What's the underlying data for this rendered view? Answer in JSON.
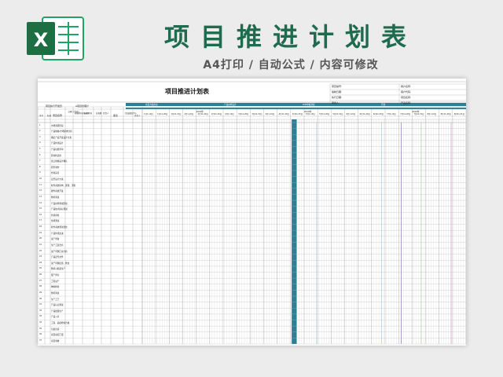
{
  "banner": {
    "title": "项目推进计划表",
    "subtitle": "A4打印 / 自动公式 / 内容可修改",
    "logo_letter": "X",
    "logo_icon": "excel-icon",
    "colors": {
      "title": "#1e6b4f",
      "logo_dark": "#1d6e42",
      "logo_light": "#21a366",
      "teal": "#2b8193"
    }
  },
  "sheet": {
    "title": "项目推进计划表",
    "info_left": [
      "项目编号:",
      "编制日期:",
      "执行日期:",
      "审批人:"
    ],
    "info_right": [
      "客户名称:",
      "客户代码:",
      "项目名称:",
      "产品名称:"
    ],
    "project_label": "项目执行开发员",
    "project_value": "A项目管理计",
    "columns": {
      "seq": "序号",
      "mark": "标记",
      "task": "项目名称",
      "start_line": "工期(工作日)",
      "plan_start": "开始时间(年-月)",
      "plan_end": "结束时间",
      "days": "总天数",
      "owner": "负责人",
      "remark": "备注",
      "progress": "完成进度(%)",
      "lead": "负责人"
    },
    "phases": [
      "项目方案启动",
      "产品初样设计",
      "PCB单板调试",
      "开始"
    ],
    "years": [
      "2019年",
      "2019年",
      "2019年"
    ],
    "months": [
      "1月1-10日",
      "1月11-20日",
      "1月21-31日",
      "2月1-10日",
      "2月11-20日",
      "2月21-29日",
      "3月1-10日",
      "3月11-20日",
      "3月21-31日",
      "4月1-10日",
      "4月11-20日",
      "4月21-30日",
      "5月1-10日",
      "5月11-20日",
      "5月21-31日",
      "6月1-10日",
      "6月11-20日",
      "6月21-30日",
      "7月1-10日",
      "7月11-20日",
      "7月21-31日",
      "8月1-10日",
      "8月11-20日",
      "8月21-31日"
    ],
    "rows": [
      "市场调研阶段",
      "产品规格/市场需求分析",
      "确定产品开发设计方案",
      "产品外观设计",
      "产品功能评审",
      "原材料选用",
      "接口规格设计确认",
      "原型制作",
      "外观完善",
      "定型设计方案",
      "软件系统架构、逻辑、流程",
      "硬件系统开发",
      "整机调试",
      "产品初样测试阶段",
      "产品技术指标测试",
      "外观审核",
      "性能测试",
      "软件系统测试优化",
      "产品外观改进",
      "试产准备",
      "生产工装治具",
      "试产问题汇总分析",
      "产品定型文件",
      "试产问题反馈、修改",
      "整机小批量生产",
      "量产评估",
      "工程试产",
      "物料检验",
      "整机调试",
      "生产工艺",
      "产品认证测试",
      "产品批量生产",
      "产品入库",
      "工程、品质检验合格",
      "包装出货",
      "项目总结汇报",
      "项目验收"
    ]
  }
}
